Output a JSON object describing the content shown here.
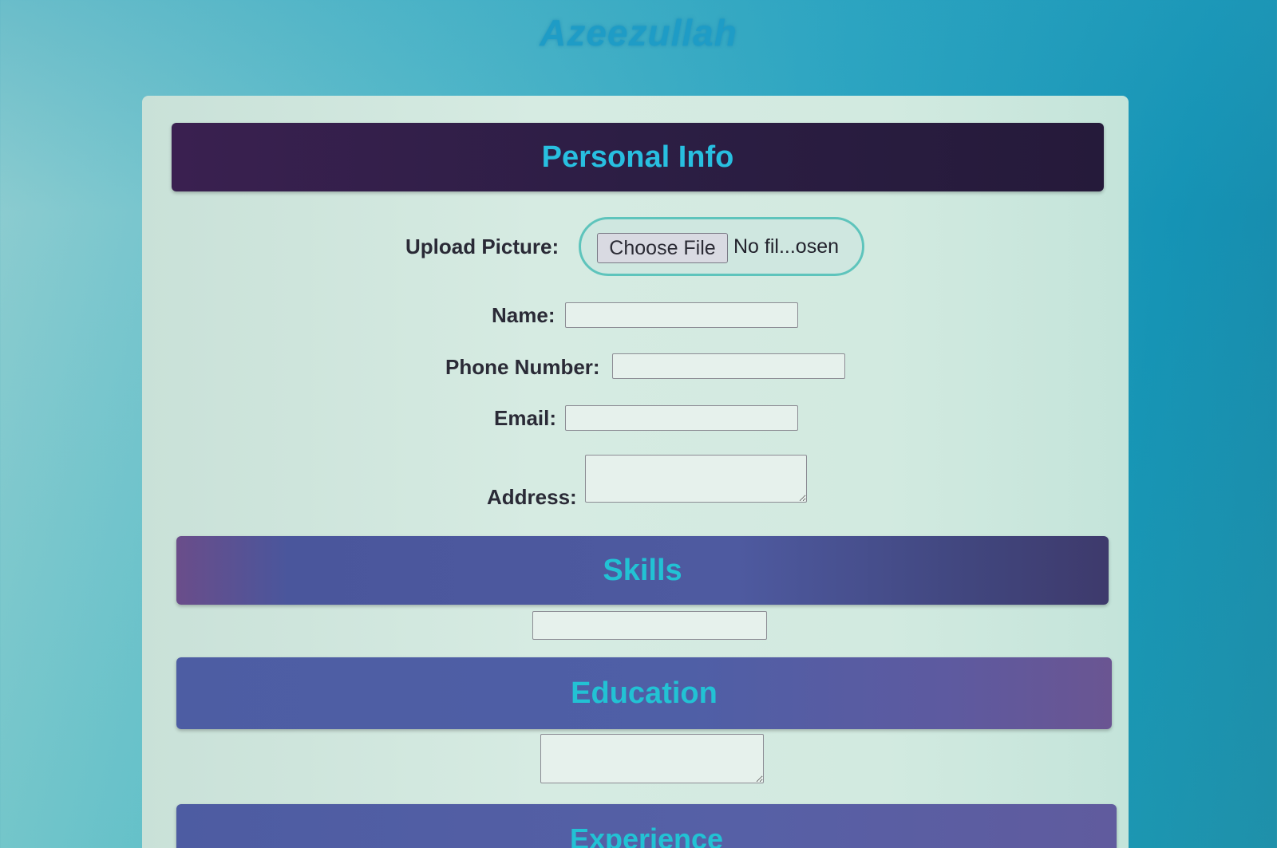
{
  "site": {
    "title": "Azeezullah"
  },
  "personal_info": {
    "heading": "Personal Info",
    "upload_label": "Upload Picture:",
    "file_button_label": "Choose File",
    "file_status": "No fil...osen",
    "name_label": "Name:",
    "name_value": "",
    "phone_label": "Phone Number:",
    "phone_value": "",
    "email_label": "Email:",
    "email_value": "",
    "address_label": "Address:",
    "address_value": ""
  },
  "skills": {
    "heading": "Skills",
    "value": ""
  },
  "education": {
    "heading": "Education",
    "value": ""
  },
  "experience": {
    "heading": "Experience"
  },
  "colors": {
    "page_accent": "#1e9cc6",
    "header_text": "#22c2d4",
    "personal_header_bg": "#2c1e44",
    "section_header_bg": "#4e5aa0",
    "card_bg": "#d6ebe2",
    "file_pill_border": "#5ec4bc"
  }
}
